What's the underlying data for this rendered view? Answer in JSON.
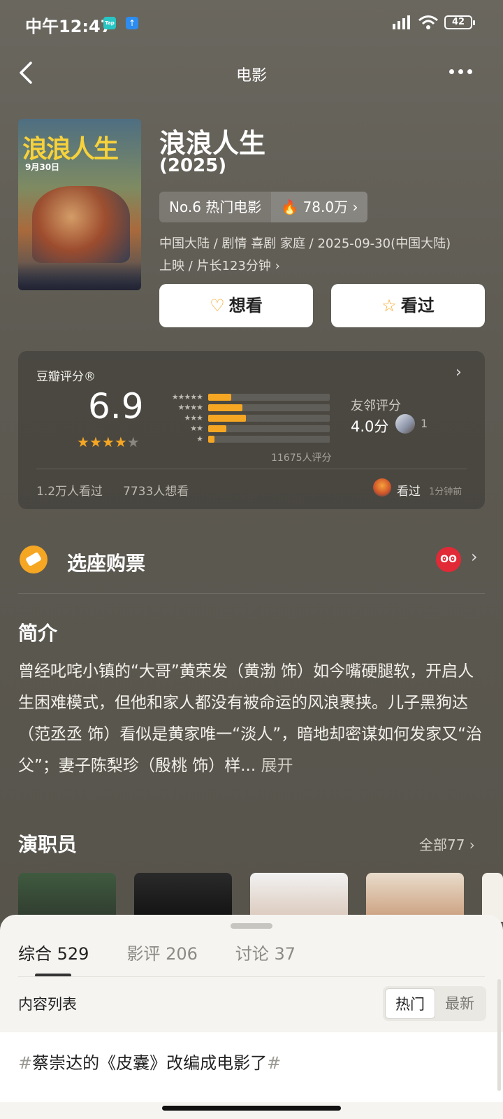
{
  "status": {
    "time": "中午12:47",
    "app1": "Tap",
    "battery": "42"
  },
  "nav": {
    "title": "电影"
  },
  "movie": {
    "title": "浪浪人生",
    "year": "(2025)",
    "poster_title": "浪浪人生",
    "poster_date": "9月30日",
    "rank_label": "No.6 热门电影",
    "heat": "78.0万",
    "meta_line1": "中国大陆 / 剧情 喜剧 家庭 / 2025-09-30(中国大陆)",
    "meta_line2": "上映 / 片长123分钟 ›",
    "want_label": "想看",
    "seen_label": "看过"
  },
  "rating": {
    "label": "豆瓣评分®",
    "score": "6.9",
    "stars_filled": 3.5,
    "distribution": [
      {
        "stars": "★★★★★",
        "fraction": 0.19
      },
      {
        "stars": "★★★★",
        "fraction": 0.28
      },
      {
        "stars": "★★★",
        "fraction": 0.31
      },
      {
        "stars": "★★",
        "fraction": 0.15
      },
      {
        "stars": "★",
        "fraction": 0.05
      }
    ],
    "count": "11675人评分",
    "friend_label": "友邻评分",
    "friend_score": "4.0分",
    "friend_count": "1",
    "seen_count": "1.2万人看过",
    "want_count": "7733人想看",
    "user_status": "看过",
    "user_time": "1分钟前"
  },
  "tickets": {
    "label": "选座购票",
    "provider": "猫眼"
  },
  "synopsis": {
    "heading": "简介",
    "text": "曾经叱咤小镇的“大哥”黄荣发（黄渤 饰）如今嘴硬腿软，开启人生困难模式，但他和家人都没有被命运的风浪裹挟。儿子黑狗达（范丞丞 饰）看似是黄家唯一“淡人”，暗地却密谋如何发家又“治父”；妻子陈梨珍（殷桃 饰）样...",
    "expand": "展开"
  },
  "cast": {
    "heading": "演职员",
    "all_label": "全部77 ›"
  },
  "sheet": {
    "tabs": [
      {
        "label": "综合 529"
      },
      {
        "label": "影评 206"
      },
      {
        "label": "讨论 37"
      }
    ],
    "list_label": "内容列表",
    "sort_hot": "热门",
    "sort_new": "最新",
    "topic_text": "蔡崇达的《皮囊》改编成电影了"
  },
  "colors": {
    "accent": "#f5a623",
    "background": "#5a574f",
    "sheet": "#f5f4f0"
  }
}
